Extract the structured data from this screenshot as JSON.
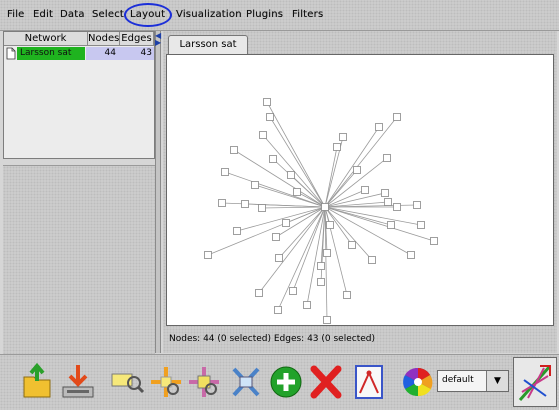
{
  "menu": [
    "File",
    "Edit",
    "Data",
    "Select",
    "Layout",
    "Visualization",
    "Plugins",
    "Filters"
  ],
  "network_table": {
    "columns": [
      "Network",
      "Nodes",
      "Edges"
    ],
    "rows": [
      {
        "name": "Larsson sat",
        "nodes": "44",
        "edges": "43"
      }
    ]
  },
  "tab_title": "Larsson sat",
  "status": "Nodes: 44 (0 selected) Edges: 43 (0 selected)",
  "visual_style": "default",
  "colors": {
    "selected_row": "#1fb31f",
    "highlight_ring": "#1c2fd8"
  },
  "toolbar_icons": [
    "open-session-icon",
    "save-session-icon",
    "zoom-in-icon",
    "zoom-out-icon",
    "zoom-selected-icon",
    "zoom-fit-icon",
    "create-network-icon",
    "delete-icon",
    "edit-attributes-icon",
    "visual-style-wheel-icon"
  ]
}
